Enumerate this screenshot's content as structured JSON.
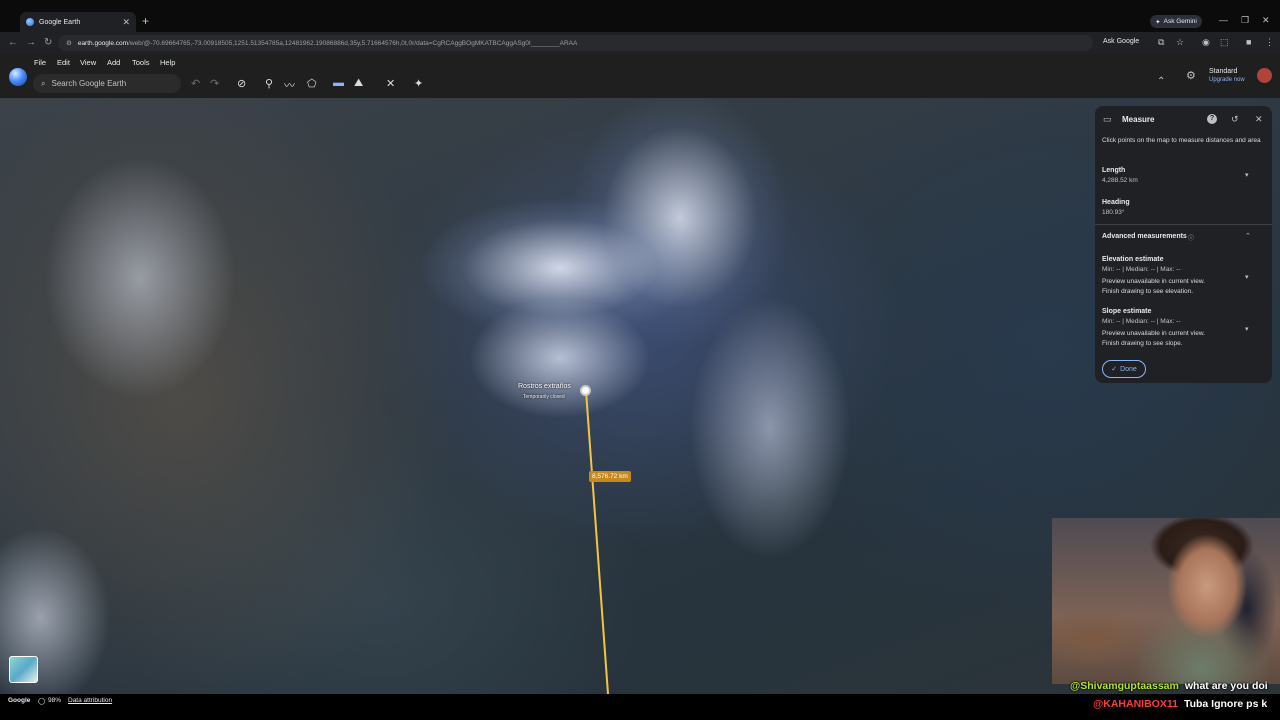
{
  "browser": {
    "tab_title": "Google Earth",
    "new_tab": "+",
    "gemini_label": "Ask Gemini",
    "url_host": "earth.google.com",
    "url_rest": "/web/@-70.69664765,-73.00918505,1251.51354785a,12481962.19086886d,35y,5.71664576h,0t,0r/data=CgRCAggBOgMKATBCAggASg0I________ARAA",
    "ask_google": "Ask Google"
  },
  "app": {
    "menu": [
      "File",
      "Edit",
      "View",
      "Add",
      "Tools",
      "Help"
    ],
    "search_placeholder": "Search Google Earth",
    "account_name": "Standard",
    "account_sub": "Upgrade now"
  },
  "map": {
    "place_name": "Rostros extraños",
    "place_status": "Temporarily closed",
    "segment_distance": "8,576.72 km",
    "route_color": "#f4c542"
  },
  "measure": {
    "title": "Measure",
    "instructions": "Click points on the map to measure distances and area",
    "length_label": "Length",
    "length_value": "4,288.52 km",
    "heading_label": "Heading",
    "heading_value": "180.93°",
    "advanced_label": "Advanced measurements",
    "elevation_label": "Elevation estimate",
    "elevation_stats": "Min: -- | Median: -- | Max: --",
    "elevation_note1": "Preview unavailable in current view.",
    "elevation_note2": "Finish drawing to see elevation.",
    "slope_label": "Slope estimate",
    "slope_stats": "Min: -- | Median: -- | Max: --",
    "slope_note1": "Preview unavailable in current view.",
    "slope_note2": "Finish drawing to see slope.",
    "done_label": "Done"
  },
  "status": {
    "google": "Google",
    "percent": "98%",
    "attribution": "Data attribution"
  },
  "chat": [
    {
      "user": "@Shivamguptaassam",
      "message": "what are you doi",
      "color": "#b5e61d"
    },
    {
      "user": "@KAHANIBOX11",
      "message": "Tuba Ignore ps k",
      "color": "#ff3b3b"
    }
  ]
}
